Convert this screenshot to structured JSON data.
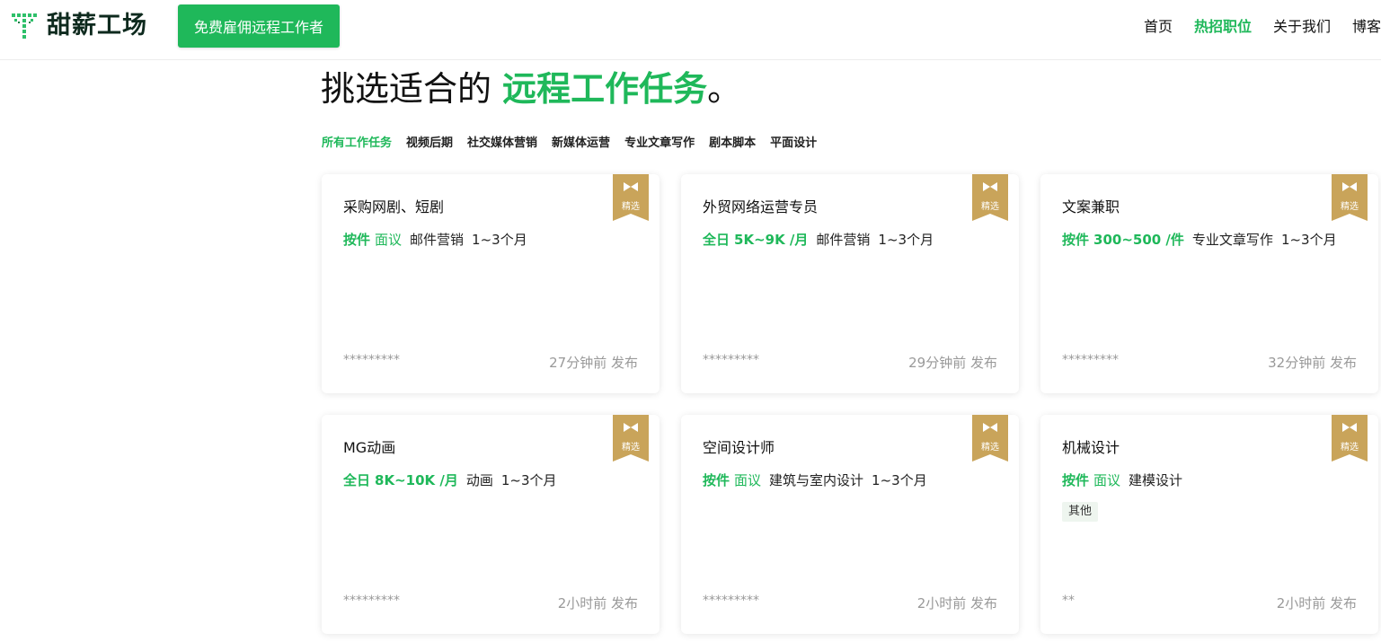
{
  "header": {
    "logo_text": "甜薪工场",
    "hire_button": "免费雇佣远程工作者",
    "nav": [
      {
        "label": "首页",
        "active": false
      },
      {
        "label": "热招职位",
        "active": true
      },
      {
        "label": "关于我们",
        "active": false
      },
      {
        "label": "博客",
        "active": false
      }
    ]
  },
  "hero": {
    "prefix": "挑选适合的",
    "accent": "远程工作任务",
    "suffix": "。"
  },
  "categories": [
    {
      "label": "所有工作任务",
      "active": true
    },
    {
      "label": "视频后期",
      "active": false
    },
    {
      "label": "社交媒体营销",
      "active": false
    },
    {
      "label": "新媒体运营",
      "active": false
    },
    {
      "label": "专业文章写作",
      "active": false
    },
    {
      "label": "剧本脚本",
      "active": false
    },
    {
      "label": "平面设计",
      "active": false
    }
  ],
  "badge_label": "精选",
  "colors": {
    "accent": "#1fb85a",
    "badge_gold": "#c9a45a"
  },
  "jobs": [
    {
      "title": "采购网剧、短剧",
      "type": "按件",
      "pay": "面议",
      "category": "邮件营销",
      "duration": "1~3个月",
      "tag": "",
      "client": "*********",
      "posted": "27分钟前 发布"
    },
    {
      "title": "外贸网络运营专员",
      "type": "全日",
      "pay": "5K~9K /月",
      "category": "邮件营销",
      "duration": "1~3个月",
      "tag": "",
      "client": "*********",
      "posted": "29分钟前 发布"
    },
    {
      "title": "文案兼职",
      "type": "按件",
      "pay": "300~500 /件",
      "category": "专业文章写作",
      "duration": "1~3个月",
      "tag": "",
      "client": "*********",
      "posted": "32分钟前 发布"
    },
    {
      "title": "MG动画",
      "type": "全日",
      "pay": "8K~10K /月",
      "category": "动画",
      "duration": "1~3个月",
      "tag": "",
      "client": "*********",
      "posted": "2小时前 发布"
    },
    {
      "title": "空间设计师",
      "type": "按件",
      "pay": "面议",
      "category": "建筑与室内设计",
      "duration": "1~3个月",
      "tag": "",
      "client": "*********",
      "posted": "2小时前 发布"
    },
    {
      "title": "机械设计",
      "type": "按件",
      "pay": "面议",
      "category": "建模设计",
      "duration": "",
      "tag": "其他",
      "client": "**",
      "posted": "2小时前 发布"
    }
  ]
}
